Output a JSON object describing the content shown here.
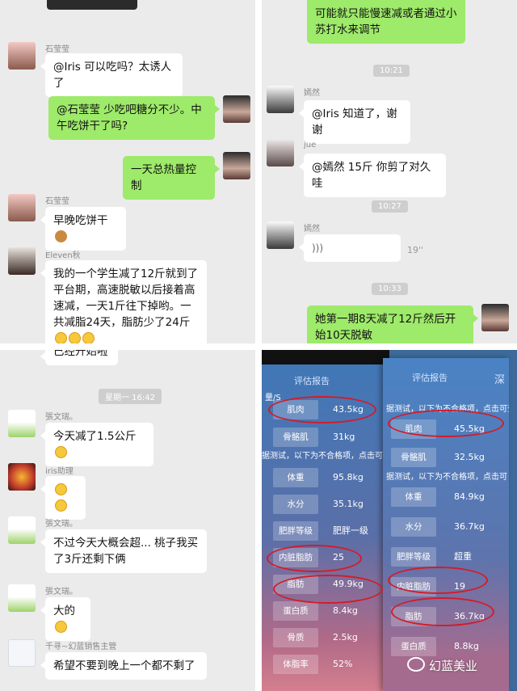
{
  "panel1": {
    "messages": [
      {
        "sender": "石莹莹",
        "text": "@Iris 可以吃吗？太诱人了"
      },
      {
        "text": "@石莹莹 少吃吧糖分不少。中午吃饼干了吗?"
      },
      {
        "text": "一天总热量控制"
      },
      {
        "sender": "石莹莹",
        "text": "早晚吃饼干"
      },
      {
        "sender": "Eleven秋",
        "text": "我的一个学生减了12斤就到了平台期，高速脱敏以后接着高速减，一天1斤往下掉哟。一共减脂24天，脂肪少了24斤"
      },
      {
        "text": "已经开始啦"
      }
    ]
  },
  "panel2": {
    "top_text": "可能就只能慢速减或者通过小苏打水来调节",
    "times": [
      "10:21",
      "10:27",
      "10:33"
    ],
    "messages": [
      {
        "sender": "嫣然",
        "text": "@Iris 知道了，谢谢"
      },
      {
        "sender": "jue",
        "text": "@嫣然 15斤  你剪了对久哇"
      },
      {
        "sender": "嫣然",
        "voice_duration": "19''"
      },
      {
        "text": "她第一期8天减了12斤然后开始10天脱敏"
      }
    ]
  },
  "panel3": {
    "time": "星期一 16:42",
    "messages": [
      {
        "sender": "張文瑞。",
        "text": "今天减了1.5公斤"
      },
      {
        "sender": "iris助理",
        "text": ""
      },
      {
        "sender": "張文瑞。",
        "text": "不过今天大概会超... 桃子我买了3斤还剩下俩"
      },
      {
        "sender": "張文瑞。",
        "text": "大的"
      },
      {
        "sender": "千寻~幻蓝销售主管",
        "text": "希望不要到晚上一个都不剩了"
      }
    ]
  },
  "report": {
    "title": "评估报告",
    "title_tail": "深",
    "note_a": "据测试，以下为不合格项，点击可",
    "note_b": "据测试，以下为不合格项，点击可查",
    "left_rows": [
      {
        "label": "肌肉",
        "value": "43.5kg"
      },
      {
        "label": "骨骼肌",
        "value": "31kg"
      },
      {
        "label": "体重",
        "value": "95.8kg"
      },
      {
        "label": "水分",
        "value": "35.1kg"
      },
      {
        "label": "肥胖等级",
        "value": "肥胖一级"
      },
      {
        "label": "内脏脂肪",
        "value": "25"
      },
      {
        "label": "脂肪",
        "value": "49.9kg"
      },
      {
        "label": "蛋白质",
        "value": "8.4kg"
      },
      {
        "label": "骨质",
        "value": "2.5kg"
      },
      {
        "label": "体脂率",
        "value": "52%"
      }
    ],
    "right_rows": [
      {
        "label": "肌肉",
        "value": "45.5kg"
      },
      {
        "label": "骨骼肌",
        "value": "32.5kg"
      },
      {
        "label": "体重",
        "value": "84.9kg"
      },
      {
        "label": "水分",
        "value": "36.7kg"
      },
      {
        "label": "肥胖等级",
        "value": "超重"
      },
      {
        "label": "内脏脂肪",
        "value": "19"
      },
      {
        "label": "脂肪",
        "value": "36.7kg"
      },
      {
        "label": "蛋白质",
        "value": "8.8kg"
      }
    ],
    "top_fragment": "量/S",
    "watermark": "幻蓝美业"
  }
}
